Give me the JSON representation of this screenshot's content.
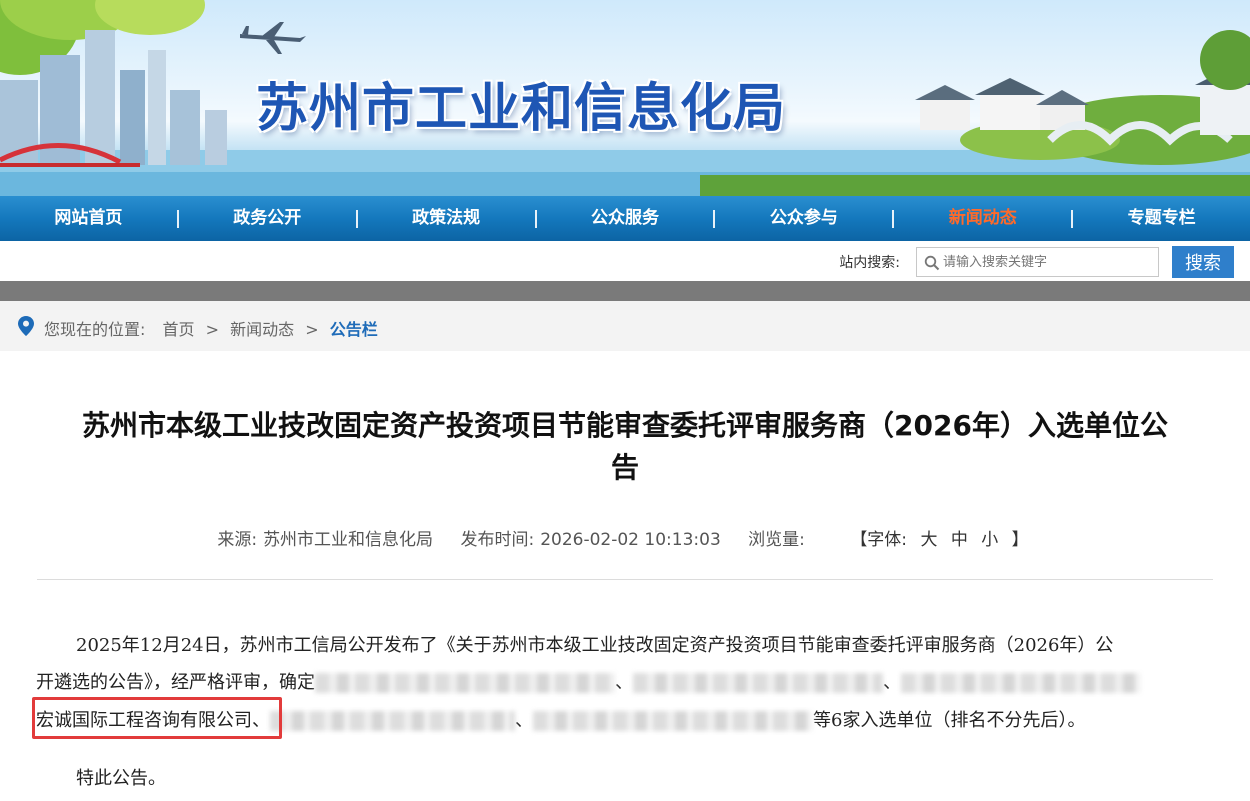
{
  "header": {
    "site_title": "苏州市工业和信息化局"
  },
  "nav": {
    "items": [
      {
        "label": "网站首页",
        "active": false
      },
      {
        "label": "政务公开",
        "active": false
      },
      {
        "label": "政策法规",
        "active": false
      },
      {
        "label": "公众服务",
        "active": false
      },
      {
        "label": "公众参与",
        "active": false
      },
      {
        "label": "新闻动态",
        "active": true
      },
      {
        "label": "专题专栏",
        "active": false
      }
    ],
    "active_color": "#ff6a2a"
  },
  "search": {
    "label": "站内搜索:",
    "placeholder": "请输入搜索关键字",
    "button_label": "搜索"
  },
  "breadcrumb": {
    "prefix": "您现在的位置:",
    "items": [
      "首页",
      "新闻动态"
    ],
    "separator": ">",
    "current": "公告栏"
  },
  "article": {
    "title_line1": "苏州市本级工业技改固定资产投资项目节能审查委托评审服务商（2026年）入选单位公",
    "title_line2": "告",
    "meta": {
      "source_label": "来源:",
      "source": "苏州市工业和信息化局",
      "time_label": "发布时间:",
      "time": "2026-02-02 10:13:03",
      "views_label": "浏览量:",
      "font_label": "【字体:",
      "font_large": "大",
      "font_medium": "中",
      "font_small": "小",
      "font_close": "】"
    },
    "para1_line1": "2025年12月24日，苏州市工信局公开发布了《关于苏州市本级工业技改固定资产投资项目节能审查委托评审服务商（2026年）公",
    "para1_line2": "开遴选的公告》，经严格评审，确定",
    "para1_line3_company": "宏诚国际工程咨询有限公司",
    "para1_line3_sep": "、",
    "para1_line3_tail": "等6家入选单位（排名不分先后）。",
    "para2": "特此公告。"
  },
  "colors": {
    "nav_blue": "#1478bd",
    "title_blue": "#1e56b4",
    "search_button": "#2f7fcb",
    "breadcrumb_current": "#1e6bb8",
    "highlight_red": "#e23b3b"
  }
}
